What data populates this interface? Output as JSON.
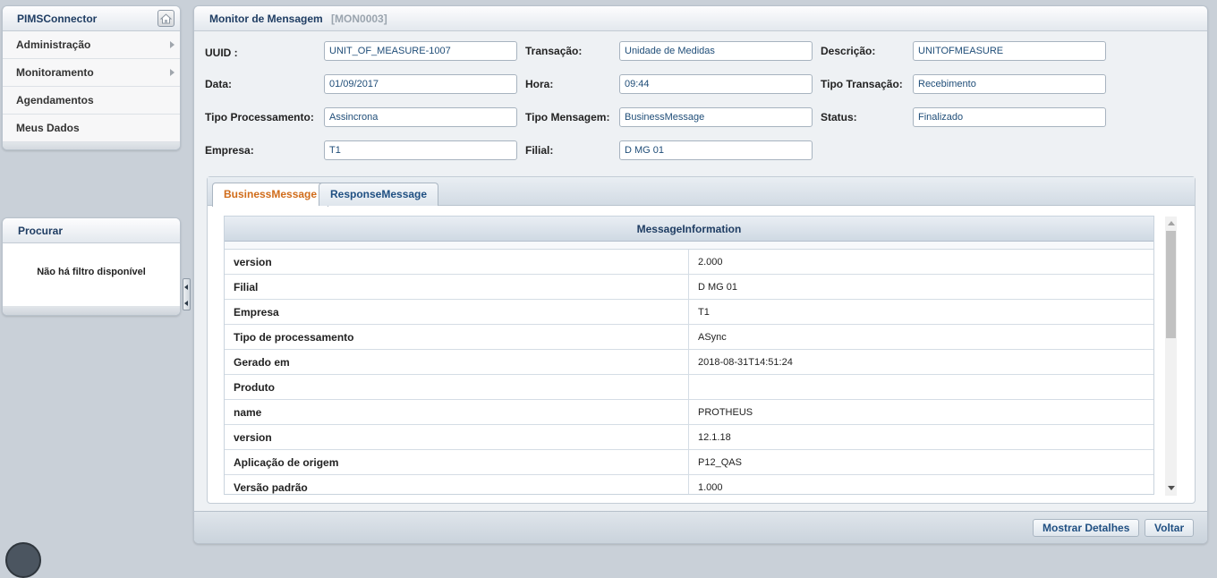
{
  "sidebar": {
    "app_title": "PIMSConnector",
    "home_icon": "home-icon",
    "items": [
      {
        "label": "Administração",
        "has_submenu": true
      },
      {
        "label": "Monitoramento",
        "has_submenu": true
      },
      {
        "label": "Agendamentos",
        "has_submenu": false
      },
      {
        "label": "Meus Dados",
        "has_submenu": false
      }
    ]
  },
  "search": {
    "title": "Procurar",
    "empty_text": "Não há filtro disponível"
  },
  "main": {
    "title": "Monitor de Mensagem",
    "code": "[MON0003]",
    "fields": {
      "uuid": {
        "label": "UUID :",
        "value": "UNIT_OF_MEASURE-1007"
      },
      "transacao": {
        "label": "Transação:",
        "value": "Unidade de Medidas"
      },
      "descricao": {
        "label": "Descrição:",
        "value": "UNITOFMEASURE"
      },
      "data": {
        "label": "Data:",
        "value": "01/09/2017"
      },
      "hora": {
        "label": "Hora:",
        "value": "09:44"
      },
      "tipo_transacao": {
        "label": "Tipo Transação:",
        "value": "Recebimento"
      },
      "tipo_processamento": {
        "label": "Tipo Processamento:",
        "value": "Assincrona"
      },
      "tipo_mensagem": {
        "label": "Tipo Mensagem:",
        "value": "BusinessMessage"
      },
      "status": {
        "label": "Status:",
        "value": "Finalizado"
      },
      "empresa": {
        "label": "Empresa:",
        "value": "T1"
      },
      "filial": {
        "label": "Filial:",
        "value": "D MG 01"
      }
    },
    "tabs": [
      {
        "label": "BusinessMessage",
        "active": true
      },
      {
        "label": "ResponseMessage",
        "active": false
      }
    ],
    "grid": {
      "header": "MessageInformation",
      "rows": [
        {
          "key": "version",
          "value": "2.000"
        },
        {
          "key": "Filial",
          "value": "D MG 01"
        },
        {
          "key": "Empresa",
          "value": "T1"
        },
        {
          "key": "Tipo de processamento",
          "value": "ASync"
        },
        {
          "key": "Gerado em",
          "value": "2018-08-31T14:51:24"
        },
        {
          "key": "Produto",
          "value": ""
        },
        {
          "key": "name",
          "value": "PROTHEUS"
        },
        {
          "key": "version",
          "value": "12.1.18"
        },
        {
          "key": "Aplicação de origem",
          "value": "P12_QAS"
        },
        {
          "key": "Versão padrão",
          "value": "1.000"
        }
      ]
    },
    "buttons": {
      "details": "Mostrar Detalhes",
      "back": "Voltar"
    }
  },
  "colors": {
    "accent_tab": "#d06c1a",
    "link_blue": "#1f4f82",
    "header_blue": "#1f3d63"
  }
}
